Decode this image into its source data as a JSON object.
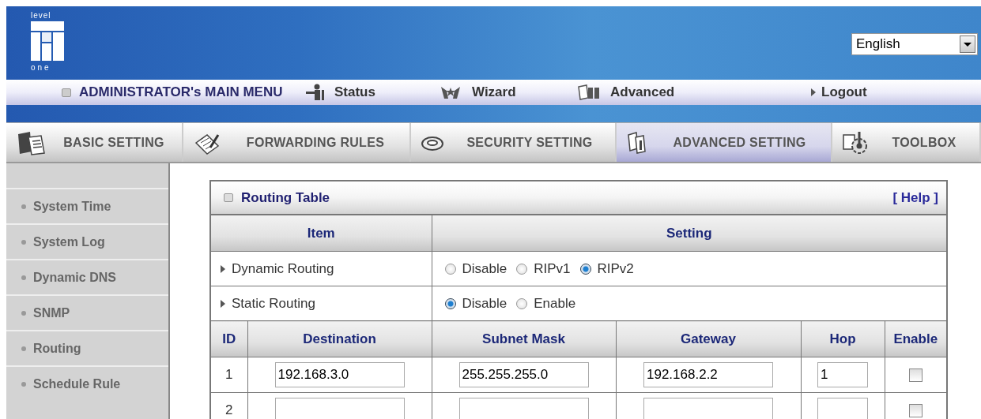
{
  "header": {
    "logo": {
      "top": "level",
      "bottom": "one"
    },
    "language": {
      "value": "English"
    }
  },
  "main_menu": {
    "title": "ADMINISTRATOR's MAIN MENU",
    "items": [
      {
        "kind": "status",
        "label": "Status"
      },
      {
        "kind": "wizard",
        "label": "Wizard"
      },
      {
        "kind": "advanced",
        "label": "Advanced"
      },
      {
        "kind": "logout",
        "label": "Logout"
      }
    ]
  },
  "tabs": [
    {
      "label": "BASIC SETTING",
      "selected": false
    },
    {
      "label": "FORWARDING RULES",
      "selected": false
    },
    {
      "label": "SECURITY SETTING",
      "selected": false
    },
    {
      "label": "ADVANCED SETTING",
      "selected": true
    },
    {
      "label": "TOOLBOX",
      "selected": false
    }
  ],
  "sidebar": {
    "items": [
      "System Time",
      "System Log",
      "Dynamic DNS",
      "SNMP",
      "Routing",
      "Schedule Rule"
    ]
  },
  "panel": {
    "title": "Routing Table",
    "help": "[ Help ]",
    "columns": [
      "Item",
      "Setting"
    ],
    "options": [
      {
        "label": "Dynamic Routing",
        "choices": [
          {
            "label": "Disable",
            "selected": false
          },
          {
            "label": "RIPv1",
            "selected": false
          },
          {
            "label": "RIPv2",
            "selected": true
          }
        ]
      },
      {
        "label": "Static Routing",
        "choices": [
          {
            "label": "Disable",
            "selected": true
          },
          {
            "label": "Enable",
            "selected": false
          }
        ]
      }
    ],
    "routes": {
      "columns": [
        "ID",
        "Destination",
        "Subnet Mask",
        "Gateway",
        "Hop",
        "Enable"
      ],
      "rows": [
        {
          "id": "1",
          "destination": "192.168.3.0",
          "subnet_mask": "255.255.255.0",
          "gateway": "192.168.2.2",
          "hop": "1",
          "enabled": false
        },
        {
          "id": "2",
          "enabled": false
        }
      ]
    }
  }
}
